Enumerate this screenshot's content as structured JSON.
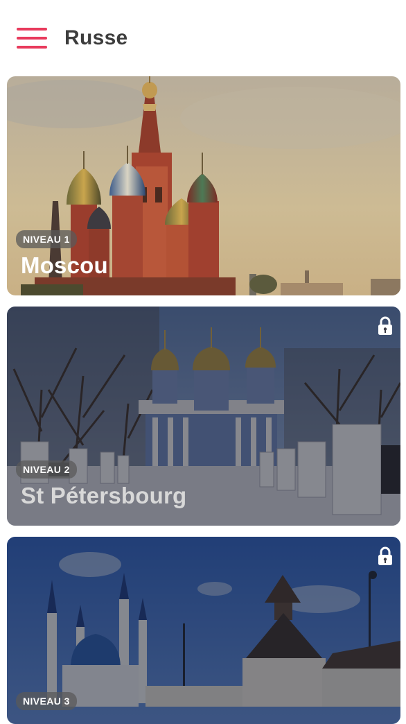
{
  "header": {
    "title": "Russe",
    "menu_icon": "hamburger-menu-icon",
    "accent": "#e83a5c"
  },
  "levels": [
    {
      "level_label": "NIVEAU 1",
      "city": "Moscou",
      "locked": false
    },
    {
      "level_label": "NIVEAU 2",
      "city": "St Pétersbourg",
      "locked": true,
      "lock_icon": "lock-icon"
    },
    {
      "level_label": "NIVEAU 3",
      "city": "",
      "locked": true,
      "lock_icon": "lock-icon"
    }
  ]
}
